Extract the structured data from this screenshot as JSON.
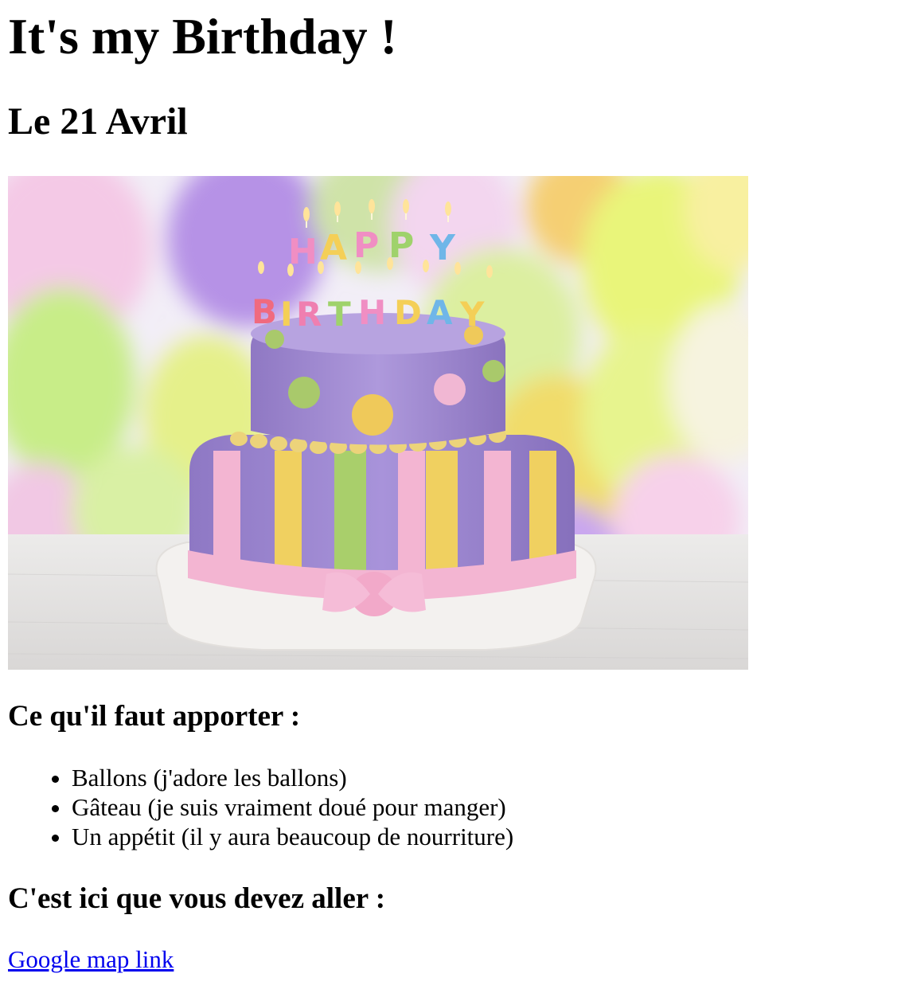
{
  "page": {
    "title": "It's my Birthday !",
    "date": "Le 21 Avril"
  },
  "image": {
    "subject": "birthday-cake-photo",
    "candle_lines": [
      "HAPPY",
      "BIRTHDAY"
    ],
    "colors": {
      "cake_top": "#a58fd4",
      "cake_bottom": "#9b83d0",
      "ribbon": "#f3b5d2",
      "yellow": "#f0d060",
      "green": "#a9cf6b",
      "board": "#f3f1ef"
    }
  },
  "bring_section": {
    "heading": "Ce qu'il faut apporter :",
    "items": [
      "Ballons (j'adore les ballons)",
      "Gâteau (je suis vraiment doué pour manger)",
      "Un appétit (il y aura beaucoup de nourriture)"
    ]
  },
  "where_section": {
    "heading": "C'est ici que vous devez aller :",
    "link_text": "Google map link",
    "link_color": "#0000ee"
  }
}
